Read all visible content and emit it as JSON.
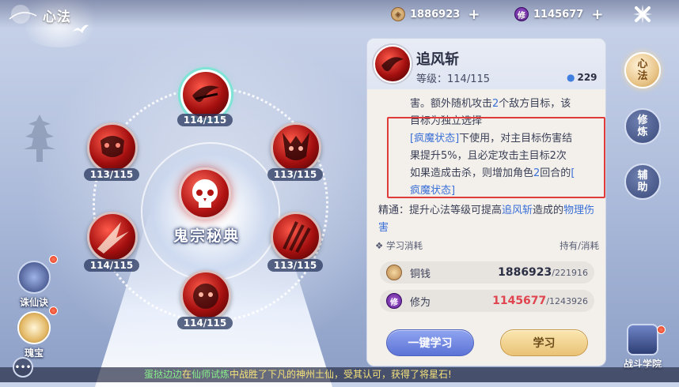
{
  "header": {
    "title": "心法",
    "resources": [
      {
        "icon": "copper-coin-icon",
        "value": "1886923"
      },
      {
        "icon": "cultivation-icon",
        "icon_text": "修",
        "value": "1145677"
      }
    ]
  },
  "skill_wheel": {
    "center_title": "鬼宗秘典",
    "nodes": [
      {
        "level": "114/115",
        "selected": true
      },
      {
        "level": "113/115"
      },
      {
        "level": "113/115"
      },
      {
        "level": "114/115"
      },
      {
        "level": "113/115"
      },
      {
        "level": "114/115"
      }
    ]
  },
  "panel": {
    "skill_name": "追风斩",
    "level_text": "等级：114/115",
    "power": "229",
    "desc_line1_a": "害。额外随机攻击",
    "desc_line1_num": "2",
    "desc_line1_b": "个敌方目标，该",
    "desc_line2": "目标为独立选择",
    "desc_status_tag": "[疯魔状态]",
    "desc_line3_b": "下使用，对主目标伤害结",
    "desc_line4": "果提升5%，且必定攻击主目标2次",
    "desc_line5_a": "如果造成击杀，则增加角色",
    "desc_line5_num": "2",
    "desc_line5_b": "回合的",
    "desc_line5_tag": "[",
    "desc_line6_tag": "疯魔状态]",
    "refine_prefix": "精通：提升心法等级可提高",
    "refine_skill": "追风斩",
    "refine_mid": "造成的",
    "refine_type": "物理伤害",
    "cost_title": "学习消耗",
    "cost_right": "持有/消耗",
    "costs": [
      {
        "icon_text": "",
        "label": "铜钱",
        "have": "1886923",
        "need": "/221916"
      },
      {
        "icon_text": "修",
        "label": "修为",
        "have": "1145677",
        "need": "/1243926"
      }
    ],
    "btn_one_key": "一键学习",
    "btn_learn": "学习"
  },
  "tabs": [
    {
      "label": "心法",
      "active": true
    },
    {
      "label": "修炼"
    },
    {
      "label": "辅助"
    }
  ],
  "side_buttons": {
    "zhuxian": "诛仙诀",
    "treasure": "瑰宝",
    "school": "战斗学院"
  },
  "ticker": {
    "prefix": "蛋挞边边",
    "mid1": "在",
    "place": "仙师试炼",
    "mid2": "中战胜了下凡的神州土仙，受其认可，获得了将星石!"
  },
  "colors": {
    "accent_blue": "#3a6fd6",
    "highlight_red": "#e03b3b",
    "panel_bg": "#f3f0ec"
  }
}
